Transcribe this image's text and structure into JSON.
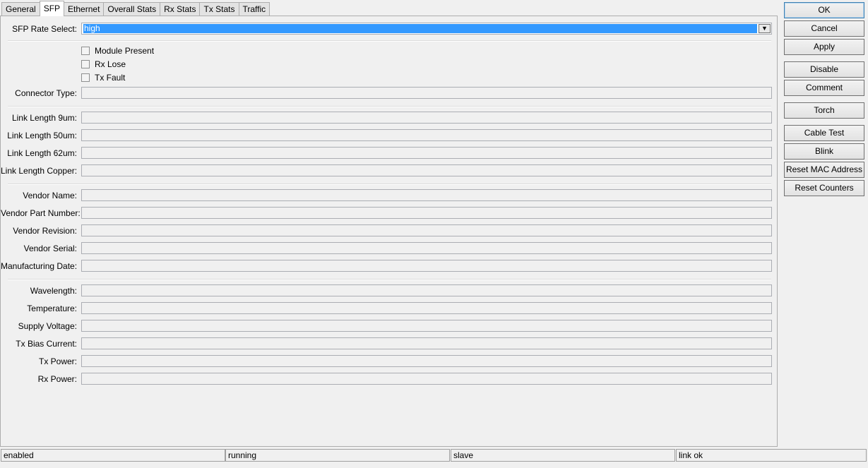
{
  "tabs": [
    {
      "label": "General"
    },
    {
      "label": "SFP",
      "active": true
    },
    {
      "label": "Ethernet"
    },
    {
      "label": "Overall Stats"
    },
    {
      "label": "Rx Stats"
    },
    {
      "label": "Tx Stats"
    },
    {
      "label": "Traffic"
    }
  ],
  "sfp": {
    "rate_select": {
      "label": "SFP Rate Select:",
      "value": "high",
      "arrow_icon": "dropdown-arrow-icon"
    },
    "checkboxes": [
      {
        "label": "Module Present",
        "checked": false
      },
      {
        "label": "Rx Lose",
        "checked": false
      },
      {
        "label": "Tx Fault",
        "checked": false
      }
    ],
    "connector_type": {
      "label": "Connector Type:",
      "value": ""
    },
    "link_length_9um": {
      "label": "Link Length 9um:",
      "value": ""
    },
    "link_length_50um": {
      "label": "Link Length 50um:",
      "value": ""
    },
    "link_length_62um": {
      "label": "Link Length 62um:",
      "value": ""
    },
    "link_length_copper": {
      "label": "Link Length Copper:",
      "value": ""
    },
    "vendor_name": {
      "label": "Vendor Name:",
      "value": ""
    },
    "vendor_part_number": {
      "label": "Vendor Part Number:",
      "value": ""
    },
    "vendor_revision": {
      "label": "Vendor Revision:",
      "value": ""
    },
    "vendor_serial": {
      "label": "Vendor Serial:",
      "value": ""
    },
    "manufacturing_date": {
      "label": "Manufacturing Date:",
      "value": ""
    },
    "wavelength": {
      "label": "Wavelength:",
      "value": ""
    },
    "temperature": {
      "label": "Temperature:",
      "value": ""
    },
    "supply_voltage": {
      "label": "Supply Voltage:",
      "value": ""
    },
    "tx_bias_current": {
      "label": "Tx Bias Current:",
      "value": ""
    },
    "tx_power": {
      "label": "Tx Power:",
      "value": ""
    },
    "rx_power": {
      "label": "Rx Power:",
      "value": ""
    }
  },
  "buttons": {
    "ok": "OK",
    "cancel": "Cancel",
    "apply": "Apply",
    "disable": "Disable",
    "comment": "Comment",
    "torch": "Torch",
    "cable_test": "Cable Test",
    "blink": "Blink",
    "reset_mac": "Reset MAC Address",
    "reset_counters": "Reset Counters"
  },
  "status": [
    "enabled",
    "running",
    "slave",
    "link ok"
  ]
}
